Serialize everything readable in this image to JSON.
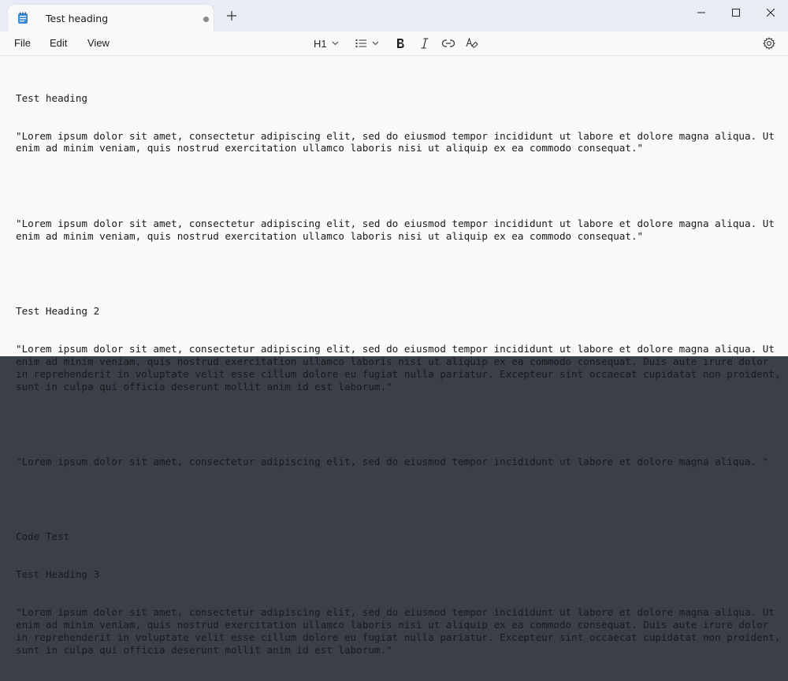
{
  "tab": {
    "title": "Test heading"
  },
  "menu": {
    "file": "File",
    "edit": "Edit",
    "view": "View"
  },
  "toolbar": {
    "heading": "H1"
  },
  "document": {
    "block1_title": "Test heading",
    "block1_p1": "\"Lorem ipsum dolor sit amet, consectetur adipiscing elit, sed do eiusmod tempor incididunt ut labore et dolore magna aliqua. Ut enim ad minim veniam, quis nostrud exercitation ullamco laboris nisi ut aliquip ex ea commodo consequat.\"",
    "block1_p2": "\"Lorem ipsum dolor sit amet, consectetur adipiscing elit, sed do eiusmod tempor incididunt ut labore et dolore magna aliqua. Ut enim ad minim veniam, quis nostrud exercitation ullamco laboris nisi ut aliquip ex ea commodo consequat.\"",
    "block2_title": "Test Heading 2",
    "block2_p1": "\"Lorem ipsum dolor sit amet, consectetur adipiscing elit, sed do eiusmod tempor incididunt ut labore et dolore magna aliqua. Ut enim ad minim veniam, quis nostrud exercitation ullamco laboris nisi ut aliquip ex ea commodo consequat. Duis aute irure dolor in reprehenderit in voluptate velit esse cillum dolore eu fugiat nulla pariatur. Excepteur sint occaecat cupidatat non proident, sunt in culpa qui officia deserunt mollit anim id est laborum.\"",
    "block2_p2": "\"Lorem ipsum dolor sit amet, consectetur adipiscing elit, sed do eiusmod tempor incididunt ut labore et dolore magna aliqua. \"",
    "code_line": "Code Test",
    "block3_title": "Test Heading 3",
    "block3_p1": "\"Lorem ipsum dolor sit amet, consectetur adipiscing elit, sed do eiusmod tempor incididunt ut labore et dolore magna aliqua. Ut enim ad minim veniam, quis nostrud exercitation ullamco laboris nisi ut aliquip ex ea commodo consequat. Duis aute irure dolor in reprehenderit in voluptate velit esse cillum dolore eu fugiat nulla pariatur. Excepteur sint occaecat cupidatat non proident, sunt in culpa qui officia deserunt mollit anim id est laborum.\""
  },
  "icons": {
    "app": "notepad-icon",
    "new_tab": "plus-icon",
    "minimize": "minimize-icon",
    "maximize": "maximize-icon",
    "close": "close-icon",
    "list": "bulleted-list-icon",
    "bold": "bold-icon",
    "italic": "italic-icon",
    "link": "link-icon",
    "clear_formatting": "clear-formatting-icon",
    "settings": "gear-icon"
  },
  "colors": {
    "titlebar": "#e8ecf4",
    "editor_bg": "#f9f9f9",
    "text": "#1a1a1a"
  }
}
